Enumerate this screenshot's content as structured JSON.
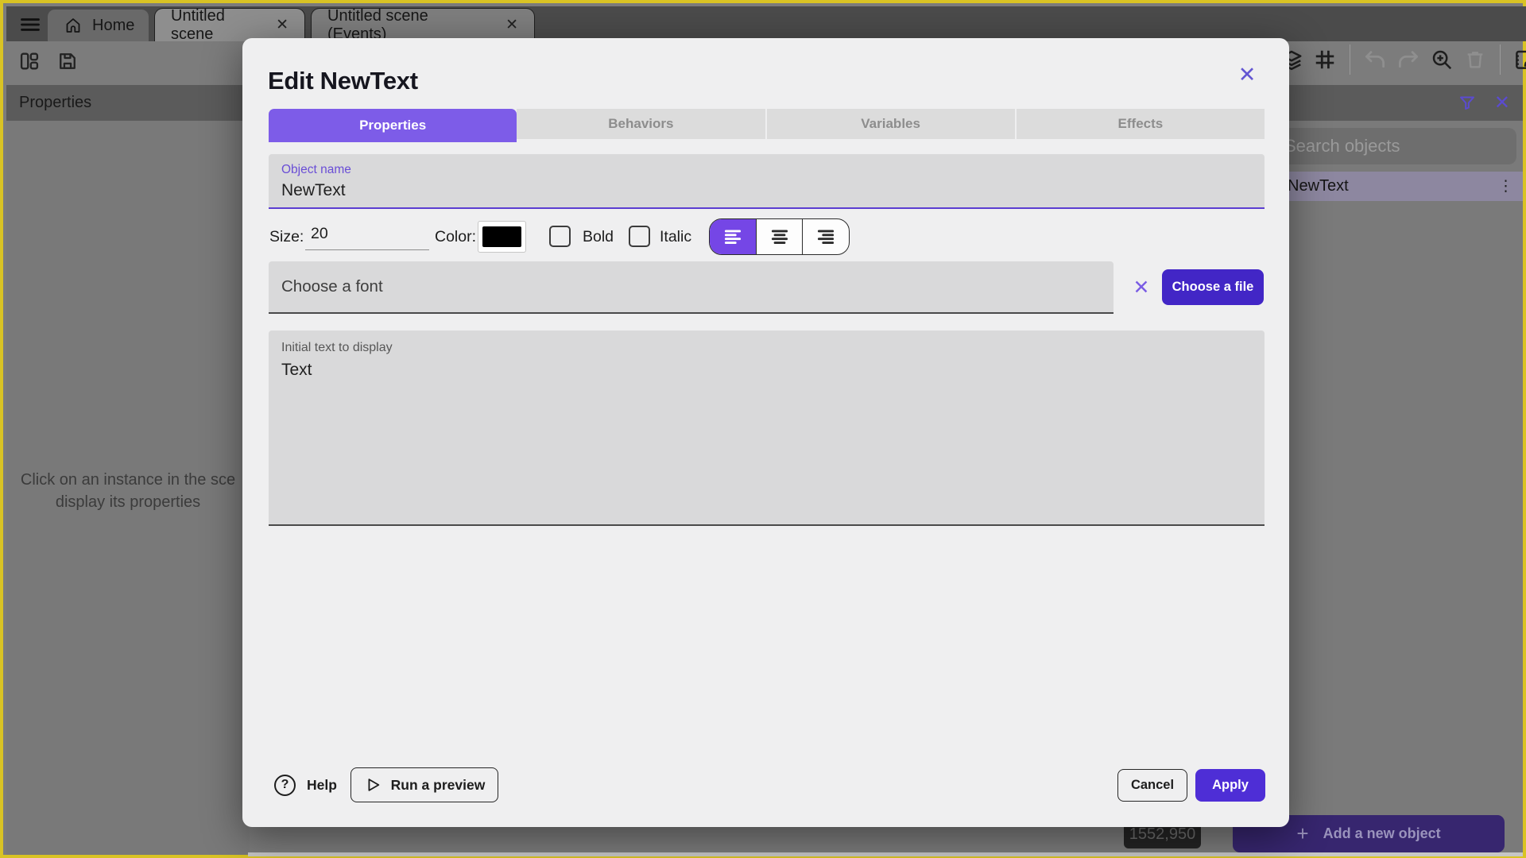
{
  "topbar": {
    "tabs": [
      {
        "label": "Home"
      },
      {
        "label": "Untitled scene"
      },
      {
        "label": "Untitled scene (Events)"
      }
    ]
  },
  "left_panel": {
    "header": "Properties",
    "message_line1": "Click on an instance in the sce",
    "message_line2": "display its properties"
  },
  "right_panel": {
    "search_placeholder": "Search objects",
    "objects": [
      {
        "name": "NewText"
      }
    ],
    "add_object_button": "Add a new object"
  },
  "canvas": {
    "coordinates_badge": "1552,950"
  },
  "modal": {
    "title": "Edit NewText",
    "tabs": [
      {
        "label": "Properties",
        "selected": true
      },
      {
        "label": "Behaviors",
        "selected": false
      },
      {
        "label": "Variables",
        "selected": false
      },
      {
        "label": "Effects",
        "selected": false
      }
    ],
    "object_name": {
      "label": "Object name",
      "value": "NewText"
    },
    "size_label": "Size:",
    "size_value": "20",
    "color_label": "Color:",
    "bold_label": "Bold",
    "italic_label": "Italic",
    "font_placeholder": "Choose a font",
    "choose_file_button": "Choose a file",
    "initial_text": {
      "label": "Initial text to display",
      "value": "Text"
    },
    "help_button": "Help",
    "run_preview_button": "Run a preview",
    "cancel_button": "Cancel",
    "apply_button": "Apply"
  },
  "icons": {
    "close_glyph": "✕",
    "kebab_glyph": "⋮",
    "plus_glyph": "+",
    "question_glyph": "?"
  },
  "colors": {
    "accent_purple": "#7d5ce8",
    "deep_purple_button": "#4226c6",
    "apply_purple": "#4e2ed6",
    "selected_object_row": "#8d87a0",
    "frame_yellow": "#d9c324",
    "text_color_value": "#000000"
  }
}
